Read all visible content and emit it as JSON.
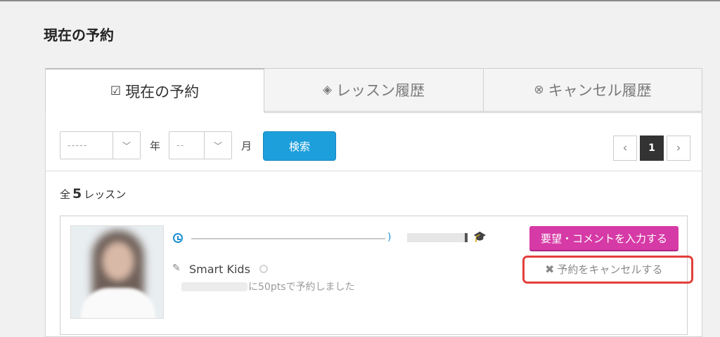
{
  "page": {
    "title": "現在の予約"
  },
  "tabs": [
    {
      "label": "現在の予約",
      "icon": "calendar-check-icon",
      "active": true
    },
    {
      "label": "レッスン履歴",
      "icon": "layers-icon",
      "active": false
    },
    {
      "label": "キャンセル履歴",
      "icon": "x-circle-icon",
      "active": false
    }
  ],
  "filters": {
    "year_value": "-----",
    "year_label": "年",
    "month_value": "--",
    "month_label": "月",
    "search_label": "検索"
  },
  "pagination": {
    "prev": "‹",
    "current": "1",
    "next": "›"
  },
  "summary": {
    "prefix": "全",
    "count": "5",
    "suffix": "レッスン"
  },
  "lesson": {
    "course": "Smart Kids",
    "booked_text": "に50ptsで予約しました",
    "comment_button": "要望・コメントを入力する",
    "cancel_link": "予約をキャンセルする",
    "cancel_icon": "✖"
  },
  "colors": {
    "accent_blue": "#1d9fdc",
    "comment_pink": "#d63aa6",
    "highlight_red": "#e2403b"
  }
}
